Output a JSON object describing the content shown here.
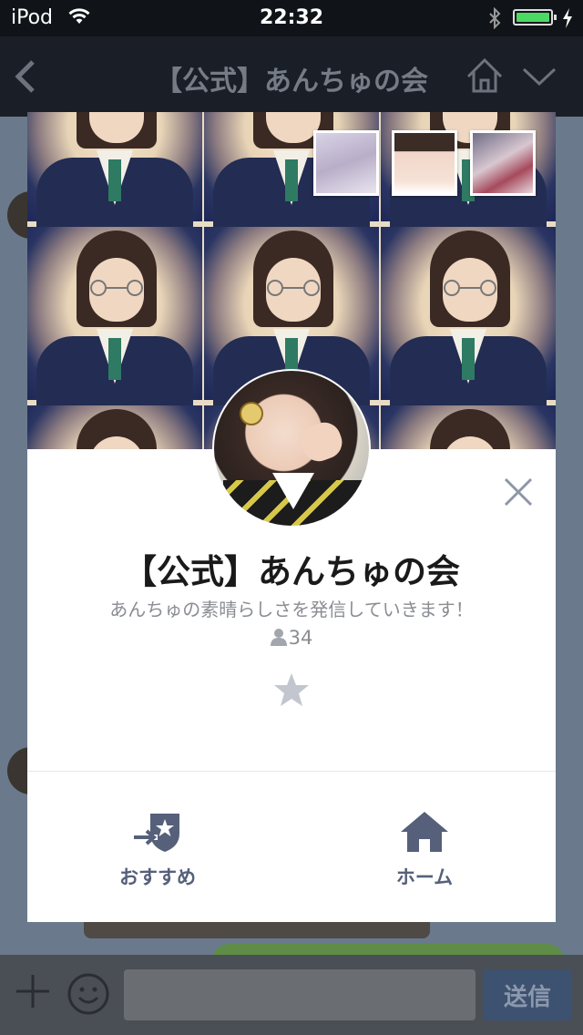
{
  "status_bar": {
    "carrier": "iPod",
    "time": "22:32",
    "icons": [
      "wifi-icon",
      "bluetooth-icon",
      "battery-icon",
      "charging-icon"
    ]
  },
  "nav": {
    "title": "【公式】あんちゅの会",
    "icons": [
      "back-chevron-icon",
      "home-icon",
      "chevron-down-icon"
    ]
  },
  "profile": {
    "name": "【公式】あんちゅの会",
    "description": "あんちゅの素晴らしさを発信していきます！",
    "friend_count": "34"
  },
  "actions": {
    "recommend_label": "おすすめ",
    "home_label": "ホーム"
  },
  "input_bar": {
    "send_label": "送信"
  },
  "colors": {
    "accent": "#56607a",
    "send_button": "#3d5170",
    "battery": "#4cd964",
    "chat_background": "#6a7a8c"
  }
}
